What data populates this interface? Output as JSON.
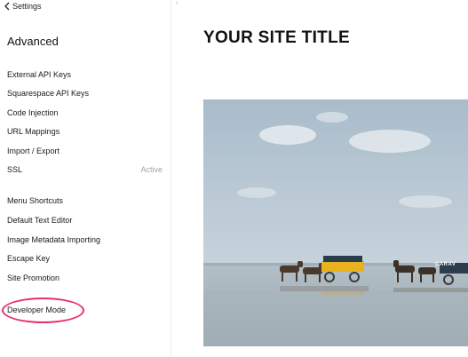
{
  "sidebar": {
    "back_label": "Settings",
    "title": "Advanced",
    "group1": [
      {
        "label": "External API Keys"
      },
      {
        "label": "Squarespace API Keys"
      },
      {
        "label": "Code Injection"
      },
      {
        "label": "URL Mappings"
      },
      {
        "label": "Import / Export"
      },
      {
        "label": "SSL",
        "status": "Active"
      }
    ],
    "group2": [
      {
        "label": "Menu Shortcuts"
      },
      {
        "label": "Default Text Editor"
      },
      {
        "label": "Image Metadata Importing"
      },
      {
        "label": "Escape Key"
      },
      {
        "label": "Site Promotion"
      }
    ],
    "developer_mode": "Developer Mode"
  },
  "preview": {
    "corner_mark": "‹",
    "site_title": "YOUR SITE TITLE",
    "hero_caption": "CARAV"
  },
  "colors": {
    "highlight": "#e8306a",
    "status_text": "#a5a5a5"
  },
  "icons": {
    "back": "chevron-left-icon"
  }
}
